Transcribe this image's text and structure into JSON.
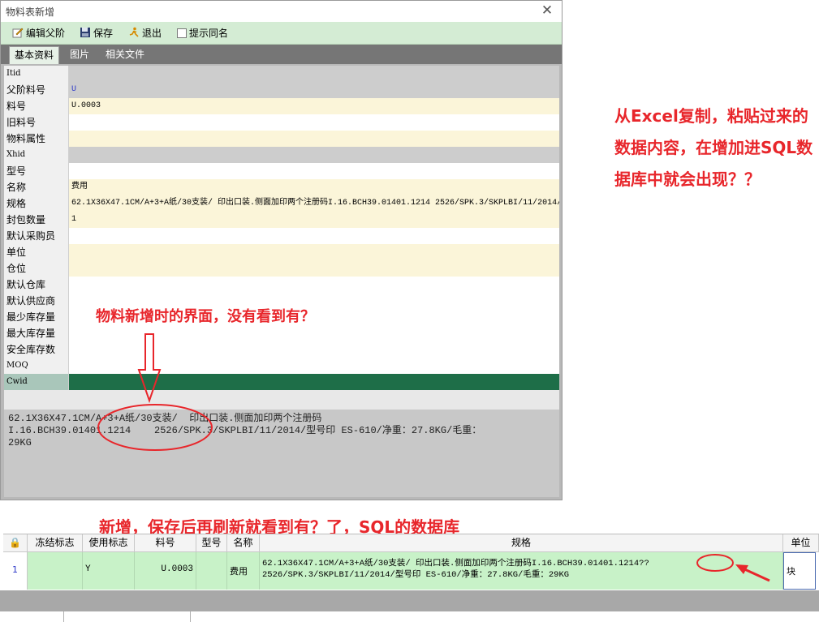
{
  "window": {
    "title": "物料表新增",
    "close_label": "✕"
  },
  "toolbar": {
    "edit_parent_label": "编辑父阶",
    "save_label": "保存",
    "exit_label": "退出",
    "hint_same_name_label": "提示同名"
  },
  "tabs": [
    {
      "label": "基本资料"
    },
    {
      "label": "图片"
    },
    {
      "label": "相关文件"
    }
  ],
  "form": {
    "rows": [
      {
        "label": "Itid",
        "value": ""
      },
      {
        "label": "父阶料号",
        "value": "U"
      },
      {
        "label": "料号",
        "value": "U.0003"
      },
      {
        "label": "旧料号",
        "value": ""
      },
      {
        "label": "物料属性",
        "value": ""
      },
      {
        "label": "Xhid",
        "value": ""
      },
      {
        "label": "型号",
        "value": ""
      },
      {
        "label": "名称",
        "value": "费用"
      },
      {
        "label": "规格",
        "value": "62.1X36X47.1CM/A+3+A纸/30支装/  印出口装.侧面加印两个注册码I.16.BCH39.01401.1214   2526/SPK.3/SKPLBI/11/2014/型号印 ES-610"
      },
      {
        "label": "封包数量",
        "value": "1"
      },
      {
        "label": "默认采购员",
        "value": ""
      },
      {
        "label": "单位",
        "value": ""
      },
      {
        "label": "仓位",
        "value": ""
      },
      {
        "label": "默认仓库",
        "value": ""
      },
      {
        "label": "默认供应商",
        "value": ""
      },
      {
        "label": "最少库存量",
        "value": ""
      },
      {
        "label": "最大库存量",
        "value": ""
      },
      {
        "label": "安全库存数",
        "value": ""
      },
      {
        "label": "MOQ",
        "value": ""
      },
      {
        "label": "Cwid",
        "value": ""
      }
    ]
  },
  "memo": {
    "text": "62.1X36X47.1CM/A+3+A纸/30支装/  印出口装.侧面加印两个注册码\nI.16.BCH39.01401.1214    2526/SPK.3/SKPLBI/11/2014/型号印 ES-610/净重：27.8KG/毛重：\n29KG"
  },
  "annotations": {
    "right": "从Excel复制，粘贴过来的数据内容，在增加进SQL数据库中就会出现？？",
    "mid": "物料新增时的界面，没有看到有？",
    "bottom": "新增，保存后再刷新就看到有？了，SQL的数据库"
  },
  "table": {
    "headers": {
      "lock": "🔒",
      "frozen": "冻结标志",
      "in_use": "使用标志",
      "item_no": "料号",
      "model": "型号",
      "name": "名称",
      "spec": "规格",
      "unit": "单位"
    },
    "row": {
      "index": "1",
      "frozen": "",
      "in_use": "Y",
      "item_no": "U.0003",
      "model": "",
      "name": "费用",
      "spec_line1": "62.1X36X47.1CM/A+3+A纸/30支装/  印出口装.侧面加印两个注册码I.16.BCH39.01401.1214??",
      "spec_line2": "2526/SPK.3/SKPLBI/11/2014/型号印 ES-610/净重：27.8KG/毛重：29KG",
      "unit": "块"
    }
  },
  "colors": {
    "annotation": "#e8262b",
    "toolbar_bg": "#d4ecd4",
    "row_green": "#c8f2c8",
    "cwid_green": "#1e6e48"
  }
}
